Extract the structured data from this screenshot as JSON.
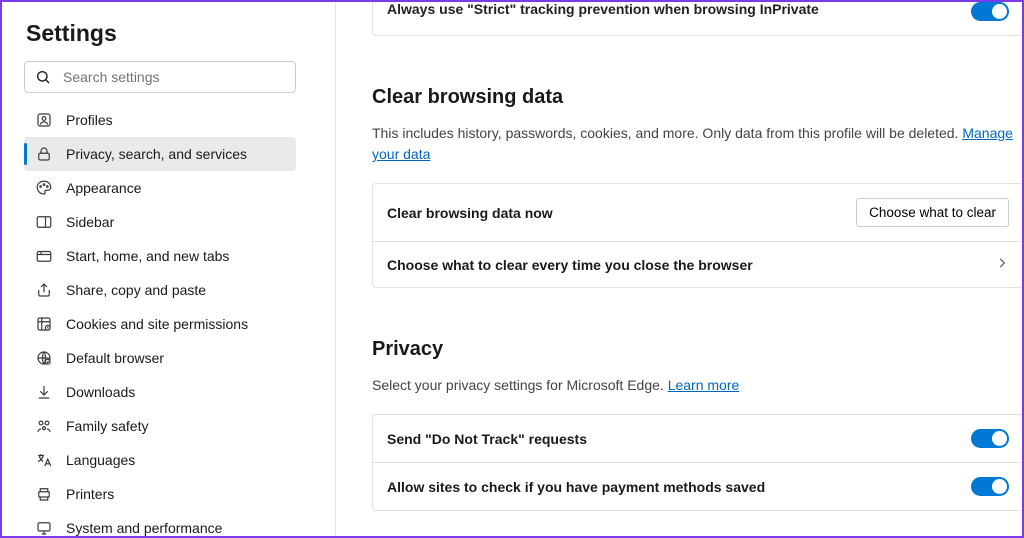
{
  "sidebar": {
    "title": "Settings",
    "search_placeholder": "Search settings",
    "items": [
      {
        "label": "Profiles"
      },
      {
        "label": "Privacy, search, and services"
      },
      {
        "label": "Appearance"
      },
      {
        "label": "Sidebar"
      },
      {
        "label": "Start, home, and new tabs"
      },
      {
        "label": "Share, copy and paste"
      },
      {
        "label": "Cookies and site permissions"
      },
      {
        "label": "Default browser"
      },
      {
        "label": "Downloads"
      },
      {
        "label": "Family safety"
      },
      {
        "label": "Languages"
      },
      {
        "label": "Printers"
      },
      {
        "label": "System and performance"
      }
    ]
  },
  "main": {
    "top_partial_label": "Always use \"Strict\" tracking prevention when browsing InPrivate",
    "clear_data": {
      "title": "Clear browsing data",
      "desc_text": "This includes history, passwords, cookies, and more. Only data from this profile will be deleted. ",
      "desc_link": "Manage your data",
      "row1_label": "Clear browsing data now",
      "row1_button": "Choose what to clear",
      "row2_label": "Choose what to clear every time you close the browser"
    },
    "privacy": {
      "title": "Privacy",
      "desc_text": "Select your privacy settings for Microsoft Edge. ",
      "desc_link": "Learn more",
      "row1_label": "Send \"Do Not Track\" requests",
      "row2_label": "Allow sites to check if you have payment methods saved"
    }
  }
}
